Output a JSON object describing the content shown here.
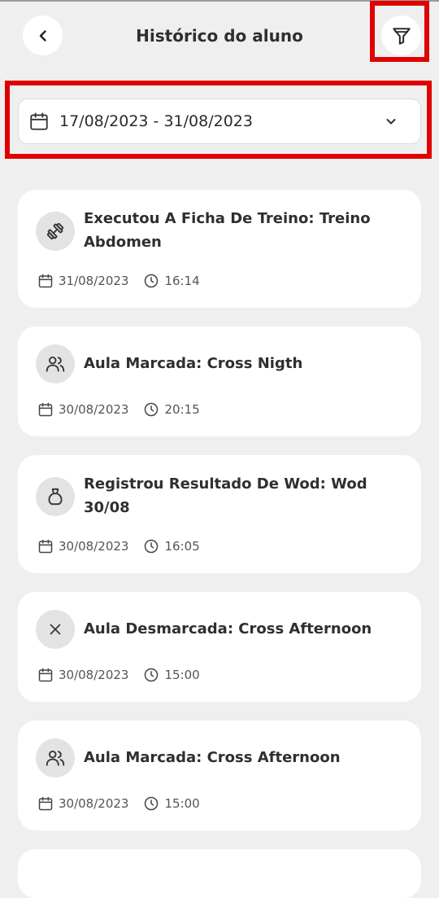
{
  "header": {
    "title": "Histórico do aluno",
    "back_icon": "chevron-left-icon",
    "filter_icon": "funnel-icon"
  },
  "date_filter": {
    "range": "17/08/2023 - 31/08/2023",
    "calendar_icon": "calendar-icon",
    "dropdown_icon": "chevron-down-icon"
  },
  "highlight_color": "#e10000",
  "history": [
    {
      "title": "Executou A Ficha De Treino: Treino Abdomen",
      "date": "31/08/2023",
      "time": "16:14",
      "icon": "dumbbell-icon"
    },
    {
      "title": "Aula Marcada: Cross Nigth",
      "date": "30/08/2023",
      "time": "20:15",
      "icon": "users-icon"
    },
    {
      "title": "Registrou Resultado De Wod: Wod 30/08",
      "date": "30/08/2023",
      "time": "16:05",
      "icon": "kettlebell-icon"
    },
    {
      "title": "Aula Desmarcada: Cross Afternoon",
      "date": "30/08/2023",
      "time": "15:00",
      "icon": "close-icon"
    },
    {
      "title": "Aula Marcada: Cross Afternoon",
      "date": "30/08/2023",
      "time": "15:00",
      "icon": "users-icon"
    }
  ]
}
